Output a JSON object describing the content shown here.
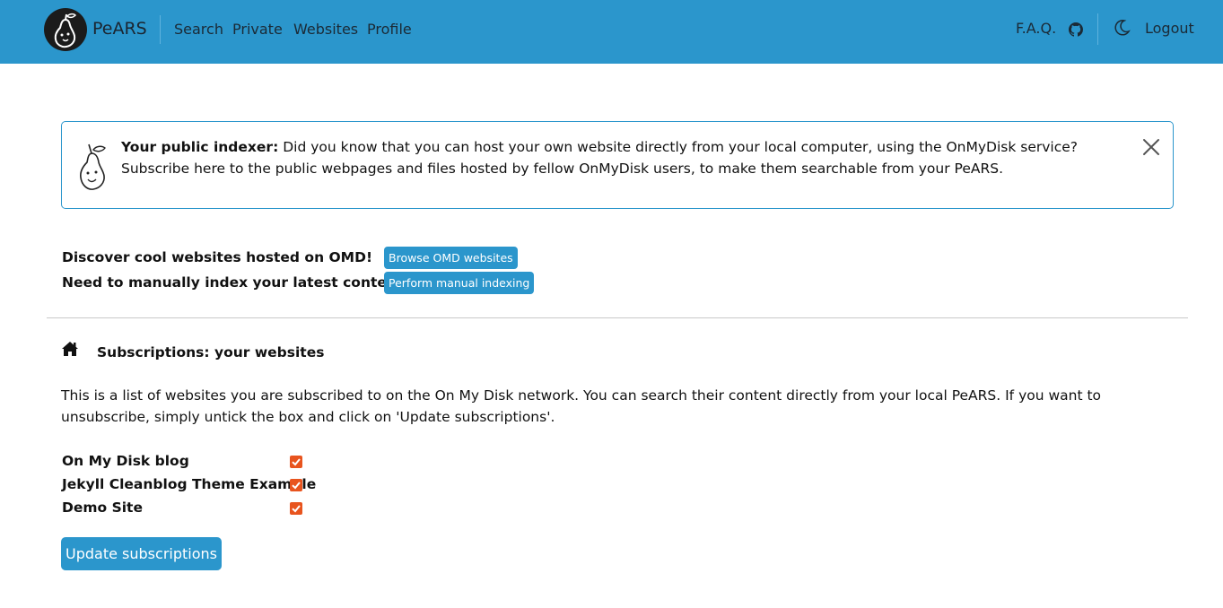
{
  "navbar": {
    "brand": "PeARS",
    "links": [
      "Search",
      "Private",
      "Websites",
      "Profile"
    ],
    "faq": "F.A.Q.",
    "logout": "Logout",
    "icons": [
      "pear-logo-icon",
      "github-icon",
      "moon-icon"
    ],
    "color": "#2b96cc"
  },
  "alert": {
    "title": "Your public indexer:",
    "body": " Did you know that you can host your own website directly from your local computer, using the OnMyDisk service? Subscribe here to the public webpages and files hosted by fellow OnMyDisk users, to make them searchable from your PeARS."
  },
  "discover": {
    "label": "Discover cool websites hosted on OMD!",
    "button": "Browse OMD websites"
  },
  "manual": {
    "label": "Need to manually index your latest content?",
    "button": "Perform manual indexing"
  },
  "subscriptions": {
    "title": "Subscriptions: your websites",
    "description": "This is a list of websites you are subscribed to on the On My Disk network. You can search their content directly from your local PeARS. If you want to unsubscribe, simply untick the box and click on 'Update subscriptions'.",
    "sites": [
      {
        "name": "On My Disk blog",
        "checked": true
      },
      {
        "name": "Jekyll Cleanblog Theme Example",
        "checked": true
      },
      {
        "name": "Demo Site",
        "checked": true
      }
    ],
    "update_button": "Update subscriptions",
    "checkbox_color": "#e8541e"
  }
}
